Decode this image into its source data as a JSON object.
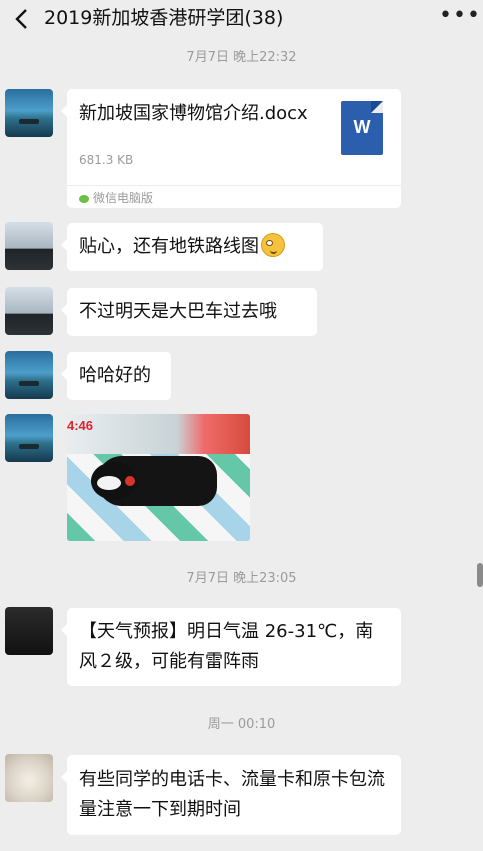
{
  "header": {
    "title": "2019新加坡香港研学团(38)"
  },
  "messages": {
    "time1": "7月7日 晚上22:32",
    "file": {
      "name": "新加坡国家博物馆介绍.docx",
      "size": "681.3 KB",
      "source": "微信电脑版",
      "icon_letter": "W"
    },
    "text1": "贴心，还有地铁路线图",
    "text2": "不过明天是大巴车过去哦",
    "text3": "哈哈好的",
    "photo_overlay": "4:46",
    "time2": "7月7日 晚上23:05",
    "weather": "【天气预报】明日气温 26-31℃，南风２级，可能有雷阵雨",
    "time3": "周一 00:10",
    "text4": "有些同学的电话卡、流量卡和原卡包流量注意一下到期时间"
  },
  "colors": {
    "background": "#ededed",
    "bubble": "#ffffff",
    "timestamp": "#9b9b9b",
    "word_icon": "#2b5fad"
  }
}
